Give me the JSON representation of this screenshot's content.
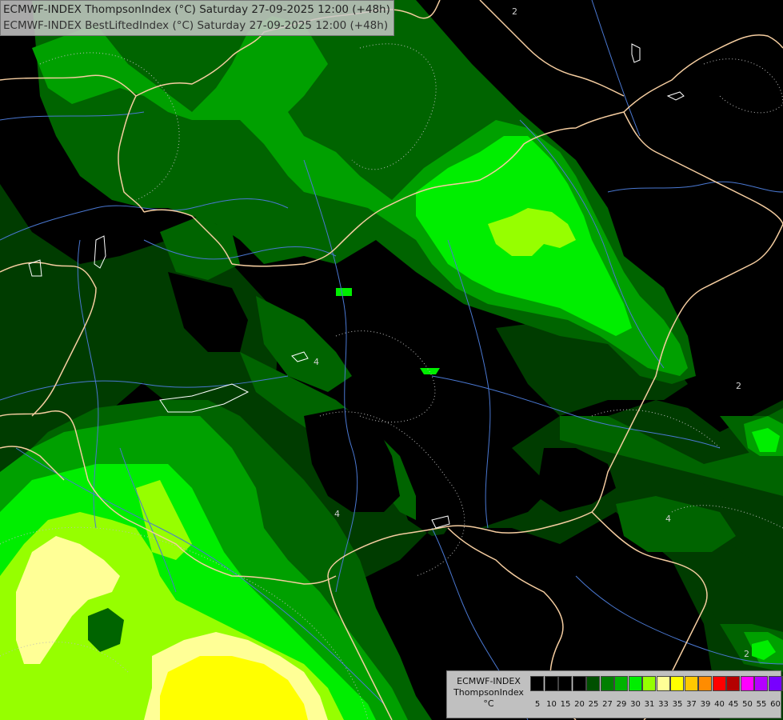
{
  "header": {
    "line1": "ECMWF-INDEX ThompsonIndex (°C) Saturday 27-09-2025 12:00 (+48h)",
    "line2": "ECMWF-INDEX BestLiftedIndex (°C) Saturday 27-09-2025 12:00 (+48h)"
  },
  "legend": {
    "model": "ECMWF-INDEX",
    "parameter": "ThompsonIndex",
    "unit": "°C",
    "colors": [
      "#000000",
      "#000000",
      "#000000",
      "#000000",
      "#005000",
      "#008000",
      "#00b400",
      "#00ee00",
      "#96ff00",
      "#ffff96",
      "#ffff00",
      "#ffc800",
      "#ff8c00",
      "#ff0000",
      "#b40000",
      "#ff00ff",
      "#b400ff",
      "#7800ff",
      "#0000ff"
    ],
    "labels": [
      "5",
      "10",
      "15",
      "20",
      "25",
      "27",
      "29",
      "30",
      "31",
      "33",
      "35",
      "37",
      "39",
      "40",
      "45",
      "50",
      "55",
      "60"
    ]
  },
  "contours": {
    "lifted_index_labels": [
      "4",
      "4",
      "2",
      "4",
      "2",
      "2"
    ]
  },
  "colors": {
    "level_20": "#003c00",
    "level_25": "#006400",
    "level_27": "#00a000",
    "level_29": "#00ee00",
    "level_30": "#96ff00",
    "level_31": "#ffff96",
    "level_33": "#ffff00",
    "borders": "#f5cda0",
    "rivers": "#4a78d2",
    "contour_lines": "#bcbcbc"
  }
}
